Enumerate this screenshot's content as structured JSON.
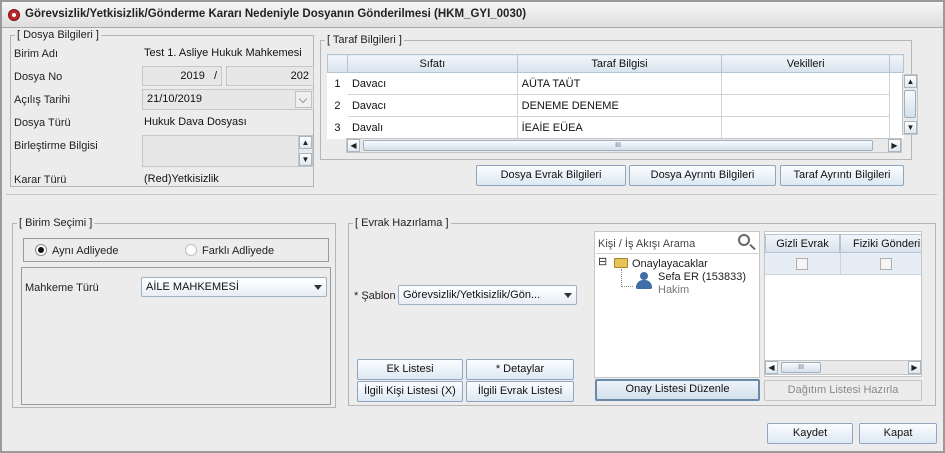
{
  "window": {
    "title": "Görevsizlik/Yetkisizlik/Gönderme Kararı Nedeniyle Dosyanın Gönderilmesi (HKM_GYI_0030)"
  },
  "dosya": {
    "legend": "[ Dosya Bilgileri ]",
    "birim_label": "Birim Adı",
    "birim_value": "Test 1. Asliye Hukuk Mahkemesi",
    "no_label": "Dosya No",
    "no_year": "2019",
    "no_sep": "/",
    "no_num": "202",
    "tarih_label": "Açılış Tarihi",
    "tarih_value": "21/10/2019",
    "tur_label": "Dosya Türü",
    "tur_value": "Hukuk Dava Dosyası",
    "birlestirme_label": "Birleştirme Bilgisi",
    "karar_label": "Karar Türü",
    "karar_value": "(Red)Yetkisizlik"
  },
  "taraf": {
    "legend": "[ Taraf Bilgileri ]",
    "columns": [
      "Sıfatı",
      "Taraf Bilgisi",
      "Vekilleri"
    ],
    "rows": [
      {
        "no": "1",
        "sifat": "Davacı",
        "bilgi": "AÜTA TAÜT",
        "vekil": ""
      },
      {
        "no": "2",
        "sifat": "Davacı",
        "bilgi": "DENEME DENEME",
        "vekil": ""
      },
      {
        "no": "3",
        "sifat": "Davalı",
        "bilgi": "İEAİE EÜEA",
        "vekil": ""
      }
    ],
    "hscroll_mark": "III",
    "buttons": {
      "evrak": "Dosya Evrak Bilgileri",
      "ayrinti": "Dosya Ayrıntı Bilgileri",
      "taraf_ayrinti": "Taraf Ayrıntı Bilgileri"
    }
  },
  "birim_secimi": {
    "legend": "[ Birim Seçimi ]",
    "radio_ayni": "Aynı Adliyede",
    "radio_farkli": "Farklı Adliyede",
    "selected": "Aynı Adliyede",
    "mahkeme_label": "Mahkeme Türü",
    "mahkeme_value": "AİLE MAHKEMESİ"
  },
  "evrak": {
    "legend": "[ Evrak Hazırlama ]",
    "sablon_label": "* Şablon",
    "sablon_value": "Görevsizlik/Yetkisizlik/Gön...",
    "search_placeholder": "Kişi / İş Akışı Arama",
    "tree_group": "Onaylayacaklar",
    "tree_toggle": "⊟",
    "tree_person": "Sefa ER (153833)",
    "tree_role": "Hakim",
    "columns": [
      "Gizli Evrak",
      "Fiziki Gönderi"
    ],
    "hscroll_mark": "III",
    "buttons": {
      "ek": "Ek Listesi",
      "detaylar": "* Detaylar",
      "ilgili_kisi": "İlgili Kişi Listesi (X)",
      "ilgili_evrak": "İlgili Evrak Listesi",
      "onay": "Onay Listesi Düzenle",
      "dagitim": "Dağıtım Listesi Hazırla"
    }
  },
  "footer": {
    "kaydet": "Kaydet",
    "kapat": "Kapat"
  }
}
